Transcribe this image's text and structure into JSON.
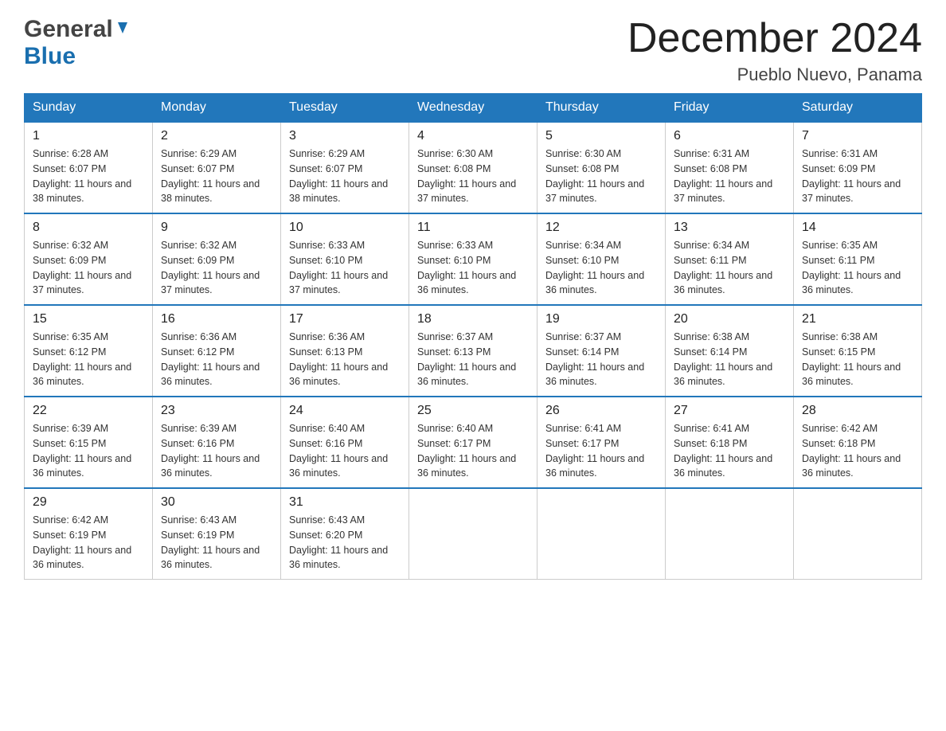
{
  "header": {
    "logo_general": "General",
    "logo_blue": "Blue",
    "month_title": "December 2024",
    "location": "Pueblo Nuevo, Panama"
  },
  "calendar": {
    "days_of_week": [
      "Sunday",
      "Monday",
      "Tuesday",
      "Wednesday",
      "Thursday",
      "Friday",
      "Saturday"
    ],
    "weeks": [
      [
        {
          "day": "1",
          "sunrise": "6:28 AM",
          "sunset": "6:07 PM",
          "daylight": "11 hours and 38 minutes."
        },
        {
          "day": "2",
          "sunrise": "6:29 AM",
          "sunset": "6:07 PM",
          "daylight": "11 hours and 38 minutes."
        },
        {
          "day": "3",
          "sunrise": "6:29 AM",
          "sunset": "6:07 PM",
          "daylight": "11 hours and 38 minutes."
        },
        {
          "day": "4",
          "sunrise": "6:30 AM",
          "sunset": "6:08 PM",
          "daylight": "11 hours and 37 minutes."
        },
        {
          "day": "5",
          "sunrise": "6:30 AM",
          "sunset": "6:08 PM",
          "daylight": "11 hours and 37 minutes."
        },
        {
          "day": "6",
          "sunrise": "6:31 AM",
          "sunset": "6:08 PM",
          "daylight": "11 hours and 37 minutes."
        },
        {
          "day": "7",
          "sunrise": "6:31 AM",
          "sunset": "6:09 PM",
          "daylight": "11 hours and 37 minutes."
        }
      ],
      [
        {
          "day": "8",
          "sunrise": "6:32 AM",
          "sunset": "6:09 PM",
          "daylight": "11 hours and 37 minutes."
        },
        {
          "day": "9",
          "sunrise": "6:32 AM",
          "sunset": "6:09 PM",
          "daylight": "11 hours and 37 minutes."
        },
        {
          "day": "10",
          "sunrise": "6:33 AM",
          "sunset": "6:10 PM",
          "daylight": "11 hours and 37 minutes."
        },
        {
          "day": "11",
          "sunrise": "6:33 AM",
          "sunset": "6:10 PM",
          "daylight": "11 hours and 36 minutes."
        },
        {
          "day": "12",
          "sunrise": "6:34 AM",
          "sunset": "6:10 PM",
          "daylight": "11 hours and 36 minutes."
        },
        {
          "day": "13",
          "sunrise": "6:34 AM",
          "sunset": "6:11 PM",
          "daylight": "11 hours and 36 minutes."
        },
        {
          "day": "14",
          "sunrise": "6:35 AM",
          "sunset": "6:11 PM",
          "daylight": "11 hours and 36 minutes."
        }
      ],
      [
        {
          "day": "15",
          "sunrise": "6:35 AM",
          "sunset": "6:12 PM",
          "daylight": "11 hours and 36 minutes."
        },
        {
          "day": "16",
          "sunrise": "6:36 AM",
          "sunset": "6:12 PM",
          "daylight": "11 hours and 36 minutes."
        },
        {
          "day": "17",
          "sunrise": "6:36 AM",
          "sunset": "6:13 PM",
          "daylight": "11 hours and 36 minutes."
        },
        {
          "day": "18",
          "sunrise": "6:37 AM",
          "sunset": "6:13 PM",
          "daylight": "11 hours and 36 minutes."
        },
        {
          "day": "19",
          "sunrise": "6:37 AM",
          "sunset": "6:14 PM",
          "daylight": "11 hours and 36 minutes."
        },
        {
          "day": "20",
          "sunrise": "6:38 AM",
          "sunset": "6:14 PM",
          "daylight": "11 hours and 36 minutes."
        },
        {
          "day": "21",
          "sunrise": "6:38 AM",
          "sunset": "6:15 PM",
          "daylight": "11 hours and 36 minutes."
        }
      ],
      [
        {
          "day": "22",
          "sunrise": "6:39 AM",
          "sunset": "6:15 PM",
          "daylight": "11 hours and 36 minutes."
        },
        {
          "day": "23",
          "sunrise": "6:39 AM",
          "sunset": "6:16 PM",
          "daylight": "11 hours and 36 minutes."
        },
        {
          "day": "24",
          "sunrise": "6:40 AM",
          "sunset": "6:16 PM",
          "daylight": "11 hours and 36 minutes."
        },
        {
          "day": "25",
          "sunrise": "6:40 AM",
          "sunset": "6:17 PM",
          "daylight": "11 hours and 36 minutes."
        },
        {
          "day": "26",
          "sunrise": "6:41 AM",
          "sunset": "6:17 PM",
          "daylight": "11 hours and 36 minutes."
        },
        {
          "day": "27",
          "sunrise": "6:41 AM",
          "sunset": "6:18 PM",
          "daylight": "11 hours and 36 minutes."
        },
        {
          "day": "28",
          "sunrise": "6:42 AM",
          "sunset": "6:18 PM",
          "daylight": "11 hours and 36 minutes."
        }
      ],
      [
        {
          "day": "29",
          "sunrise": "6:42 AM",
          "sunset": "6:19 PM",
          "daylight": "11 hours and 36 minutes."
        },
        {
          "day": "30",
          "sunrise": "6:43 AM",
          "sunset": "6:19 PM",
          "daylight": "11 hours and 36 minutes."
        },
        {
          "day": "31",
          "sunrise": "6:43 AM",
          "sunset": "6:20 PM",
          "daylight": "11 hours and 36 minutes."
        },
        null,
        null,
        null,
        null
      ]
    ]
  }
}
